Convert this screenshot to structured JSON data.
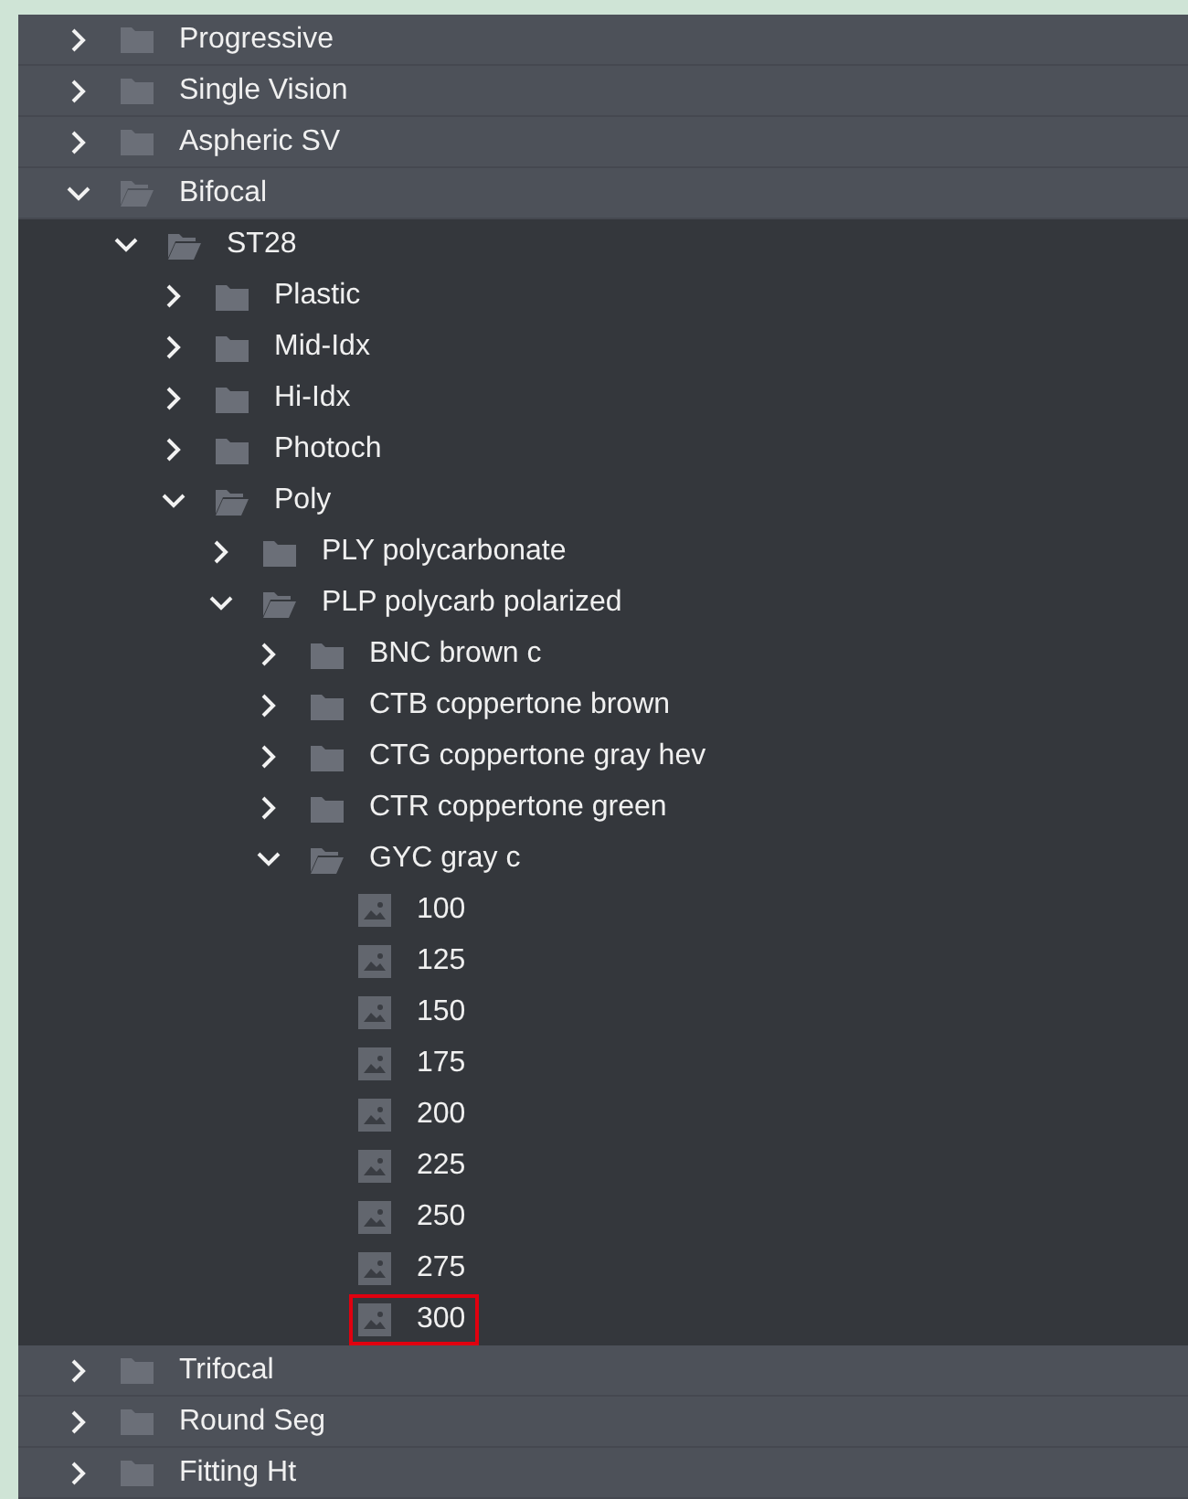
{
  "tree": [
    {
      "kind": "folder",
      "label": "Progressive",
      "expanded": false
    },
    {
      "kind": "folder",
      "label": "Single Vision",
      "expanded": false
    },
    {
      "kind": "folder",
      "label": "Aspheric SV",
      "expanded": false
    },
    {
      "kind": "folder",
      "label": "Bifocal",
      "expanded": true,
      "children": [
        {
          "kind": "folder",
          "label": "ST28",
          "expanded": true,
          "children": [
            {
              "kind": "folder",
              "label": "Plastic",
              "expanded": false
            },
            {
              "kind": "folder",
              "label": "Mid-Idx",
              "expanded": false
            },
            {
              "kind": "folder",
              "label": "Hi-Idx",
              "expanded": false
            },
            {
              "kind": "folder",
              "label": "Photoch",
              "expanded": false
            },
            {
              "kind": "folder",
              "label": "Poly",
              "expanded": true,
              "children": [
                {
                  "kind": "folder",
                  "label": "PLY polycarbonate",
                  "expanded": false
                },
                {
                  "kind": "folder",
                  "label": "PLP polycarb polarized",
                  "expanded": true,
                  "children": [
                    {
                      "kind": "folder",
                      "label": "BNC brown c",
                      "expanded": false
                    },
                    {
                      "kind": "folder",
                      "label": "CTB coppertone brown",
                      "expanded": false
                    },
                    {
                      "kind": "folder",
                      "label": "CTG coppertone gray hev",
                      "expanded": false
                    },
                    {
                      "kind": "folder",
                      "label": "CTR coppertone green",
                      "expanded": false
                    },
                    {
                      "kind": "folder",
                      "label": "GYC gray c",
                      "expanded": true,
                      "children": [
                        {
                          "kind": "image",
                          "label": "100",
                          "selected": false
                        },
                        {
                          "kind": "image",
                          "label": "125",
                          "selected": false
                        },
                        {
                          "kind": "image",
                          "label": "150",
                          "selected": false
                        },
                        {
                          "kind": "image",
                          "label": "175",
                          "selected": false
                        },
                        {
                          "kind": "image",
                          "label": "200",
                          "selected": false
                        },
                        {
                          "kind": "image",
                          "label": "225",
                          "selected": false
                        },
                        {
                          "kind": "image",
                          "label": "250",
                          "selected": false
                        },
                        {
                          "kind": "image",
                          "label": "275",
                          "selected": false
                        },
                        {
                          "kind": "image",
                          "label": "300",
                          "selected": true
                        }
                      ]
                    }
                  ]
                }
              ]
            }
          ]
        }
      ]
    },
    {
      "kind": "folder",
      "label": "Trifocal",
      "expanded": false
    },
    {
      "kind": "folder",
      "label": "Round Seg",
      "expanded": false
    },
    {
      "kind": "folder",
      "label": "Fitting Ht",
      "expanded": false
    }
  ]
}
